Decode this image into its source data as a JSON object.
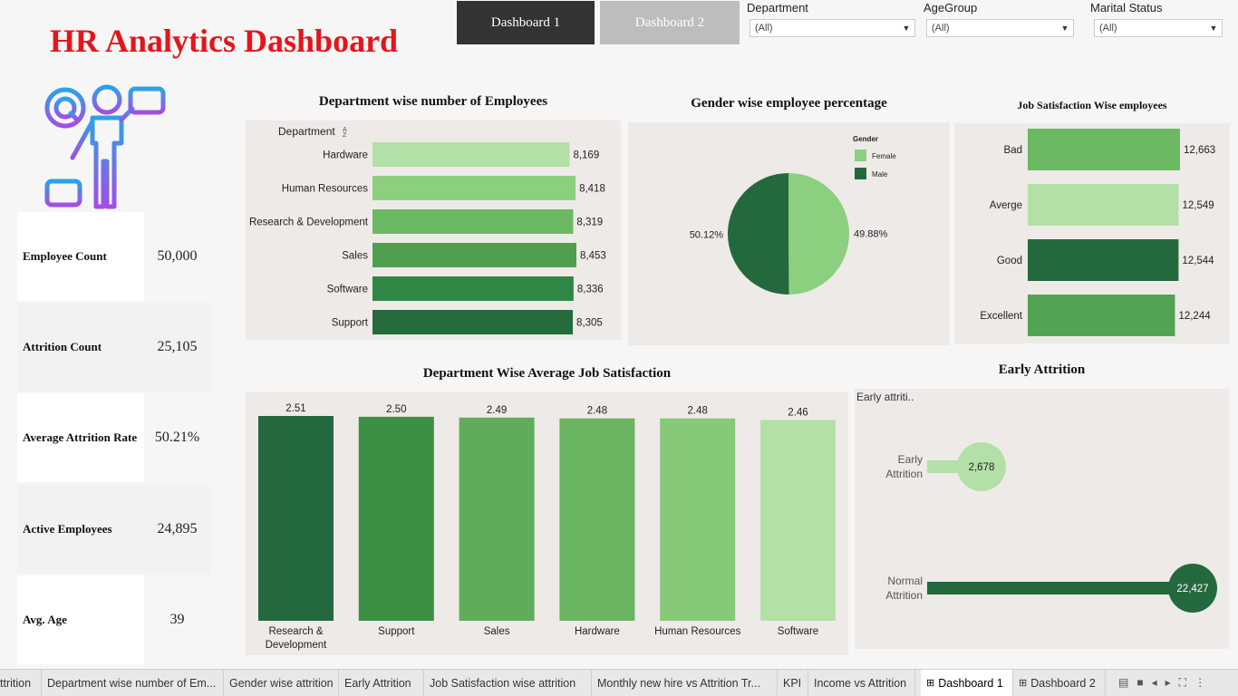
{
  "header": {
    "title": "HR Analytics Dashboard",
    "nav": [
      "Dashboard 1",
      "Dashboard 2"
    ],
    "filters": [
      {
        "label": "Department",
        "value": "(All)"
      },
      {
        "label": "AgeGroup",
        "value": "(All)"
      },
      {
        "label": "Marital Status",
        "value": "(All)"
      }
    ]
  },
  "kpis": [
    {
      "label": "Employee Count",
      "value": "50,000"
    },
    {
      "label": "Attrition Count",
      "value": "25,105"
    },
    {
      "label": "Average Attrition Rate",
      "value": "50.21%"
    },
    {
      "label": "Active Employees",
      "value": "24,895"
    },
    {
      "label": "Avg. Age",
      "value": "39"
    }
  ],
  "chart_data": [
    {
      "id": "dept_employees",
      "type": "bar",
      "orientation": "horizontal",
      "title": "Department wise number of Employees",
      "axis_header": "Department",
      "categories": [
        "Hardware",
        "Human Resources",
        "Research & Development",
        "Sales",
        "Software",
        "Support"
      ],
      "values": [
        8169,
        8418,
        8319,
        8453,
        8336,
        8305
      ],
      "labels": [
        "8,169",
        "8,418",
        "8,319",
        "8,453",
        "8,336",
        "8,305"
      ],
      "colors": [
        "#b3e0a6",
        "#8ccf7e",
        "#6cb963",
        "#4f9f4f",
        "#2f8746",
        "#256b3c"
      ]
    },
    {
      "id": "gender_pct",
      "type": "pie",
      "title": "Gender wise employee percentage",
      "legend_title": "Gender",
      "legend_position": "top-right",
      "categories": [
        "Female",
        "Male"
      ],
      "values": [
        49.88,
        50.12
      ],
      "labels": [
        "49.88%",
        "50.12%"
      ],
      "colors": [
        "#8ccf7e",
        "#24693d"
      ]
    },
    {
      "id": "job_satisfaction",
      "type": "bar",
      "orientation": "horizontal",
      "title": "Job Satisfaction Wise employees",
      "categories": [
        "Bad",
        "Averge",
        "Good",
        "Excellent"
      ],
      "values": [
        12663,
        12549,
        12544,
        12244
      ],
      "labels": [
        "12,663",
        "12,549",
        "12,544",
        "12,244"
      ],
      "colors": [
        "#6cb963",
        "#b3e0a6",
        "#24693d",
        "#52a454"
      ]
    },
    {
      "id": "dept_avg_satisfaction",
      "type": "bar",
      "orientation": "vertical",
      "title": "Department Wise Average Job Satisfaction",
      "categories": [
        "Research & Development",
        "Support",
        "Sales",
        "Hardware",
        "Human Resources",
        "Software"
      ],
      "values": [
        2.51,
        2.5,
        2.49,
        2.48,
        2.48,
        2.46
      ],
      "labels": [
        "2.51",
        "2.50",
        "2.49",
        "2.48",
        "2.48",
        "2.46"
      ],
      "colors": [
        "#24693d",
        "#3c8f45",
        "#60ac5a",
        "#6ab462",
        "#86c978",
        "#b3e0a6"
      ]
    },
    {
      "id": "early_attrition",
      "type": "bar",
      "orientation": "horizontal",
      "title": "Early Attrition",
      "axis_header": "Early attriti..",
      "categories": [
        "Early Attrition",
        "Normal Attrition"
      ],
      "values": [
        2678,
        22427
      ],
      "labels": [
        "2,678",
        "22,427"
      ],
      "colors": [
        "#b3e0a6",
        "#24693d"
      ]
    }
  ],
  "tabs": [
    "ttrition",
    "Department wise number of Em...",
    "Gender wise attrition",
    "Early Attrition",
    "Job Satisfaction wise attrition",
    "Monthly new hire vs Attrition Tr...",
    "KPI",
    "Income vs Attrition",
    "Dashboard 1",
    "Dashboard 2"
  ],
  "active_tab": "Dashboard 1"
}
